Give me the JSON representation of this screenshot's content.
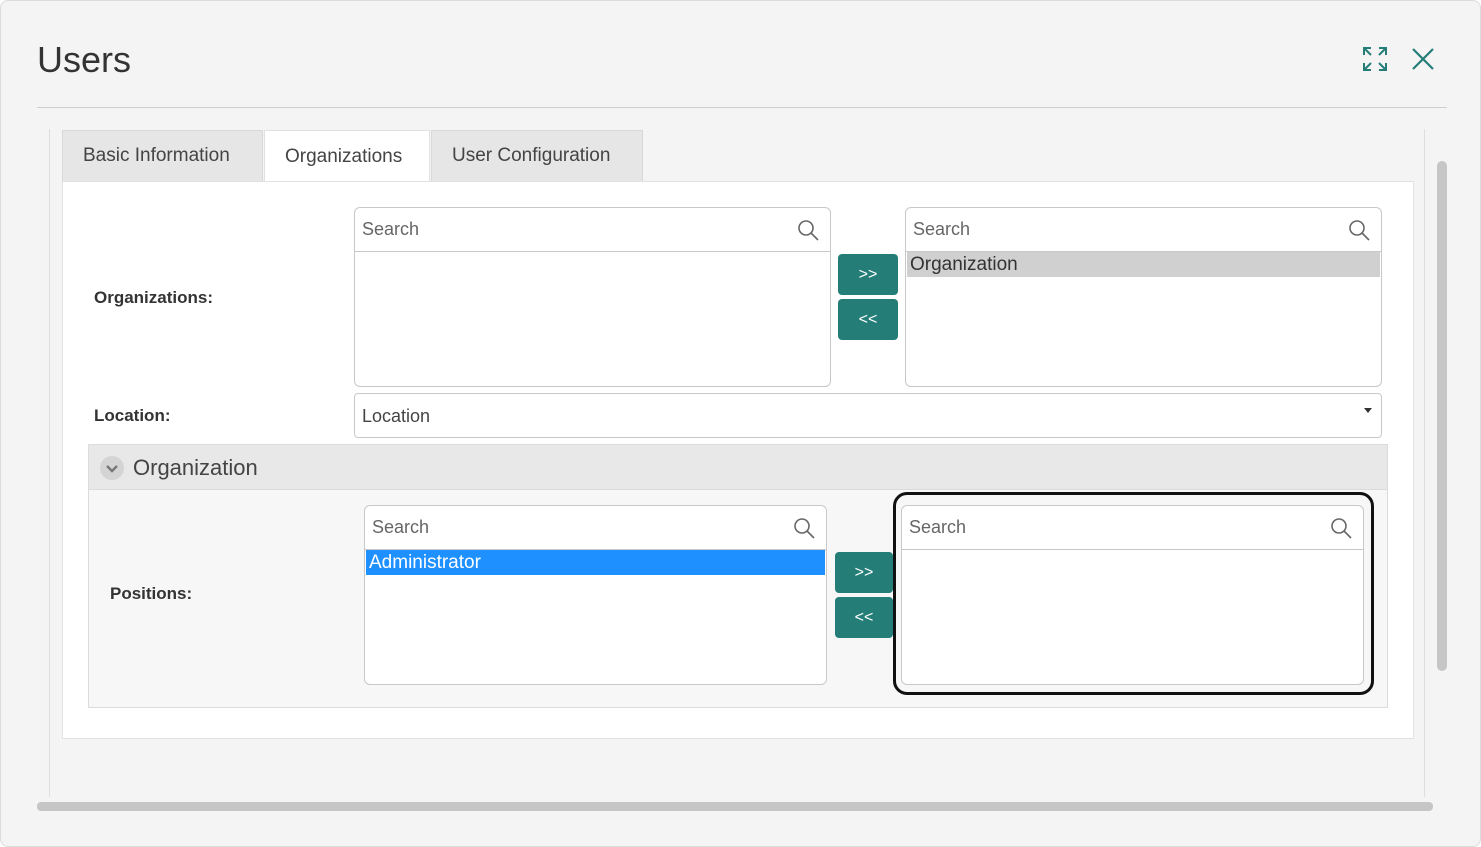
{
  "dialog": {
    "title": "Users"
  },
  "tabs": [
    {
      "label": "Basic Information"
    },
    {
      "label": "Organizations"
    },
    {
      "label": "User Configuration"
    }
  ],
  "active_tab": "Organizations",
  "organizations": {
    "label": "Organizations:",
    "available": {
      "search_placeholder": "Search",
      "items": []
    },
    "selected": {
      "search_placeholder": "Search",
      "items": [
        "Organization"
      ]
    },
    "add_button": ">>",
    "remove_button": "<<"
  },
  "location": {
    "label": "Location:",
    "value": "Location"
  },
  "organization_section": {
    "title": "Organization",
    "expanded": true,
    "positions": {
      "label": "Positions:",
      "available": {
        "search_placeholder": "Search",
        "items": [
          "Administrator"
        ]
      },
      "selected": {
        "search_placeholder": "Search",
        "items": []
      },
      "add_button": ">>",
      "remove_button": "<<"
    }
  },
  "colors": {
    "accent": "#257d78",
    "selection": "#1e90ff",
    "item_highlight": "#d0d0d0"
  },
  "icons": {
    "expand": "expand-icon",
    "close": "close-icon",
    "search": "search-icon",
    "collapse": "chevron-down-icon"
  }
}
